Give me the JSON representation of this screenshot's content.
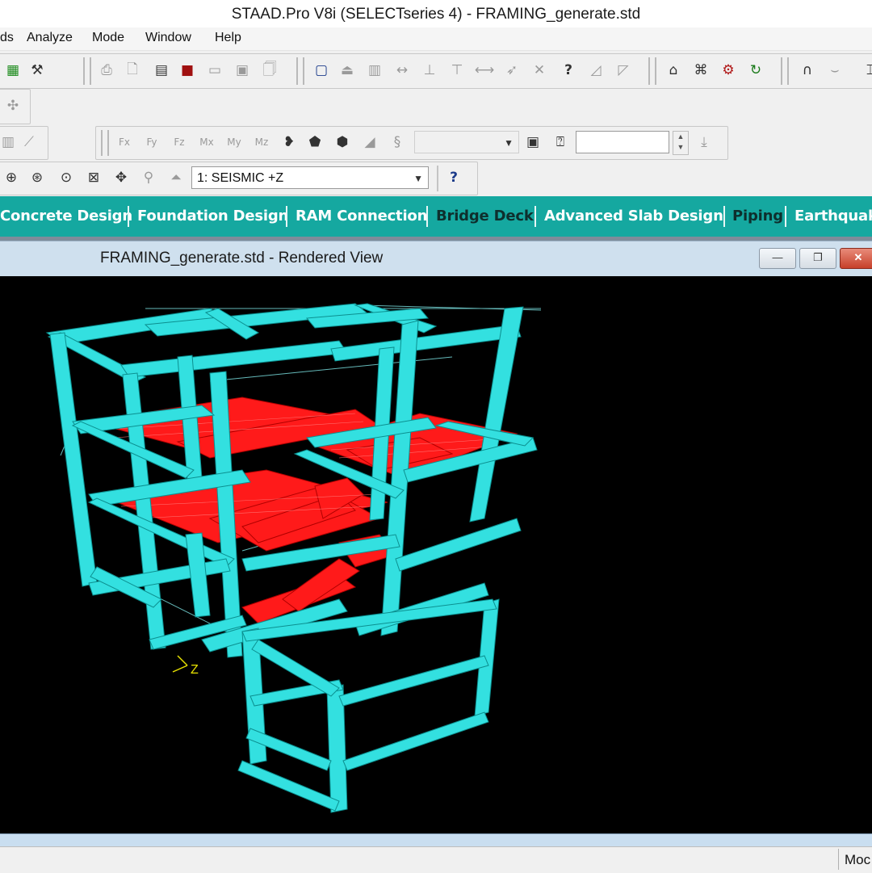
{
  "window": {
    "title": "STAAD.Pro V8i (SELECTseries 4) - FRAMING_generate.std"
  },
  "menu": {
    "items": [
      "ds",
      "Analyze",
      "Mode",
      "Window",
      "Help"
    ]
  },
  "toolbar": {
    "load_case_combo": {
      "value": "1: SEISMIC +Z"
    },
    "help_label": "?",
    "icons": [
      "build-icon",
      "hammer-icon",
      "print-icon",
      "print-preview-icon",
      "calculator-icon",
      "camera-icon",
      "snapshot-icon",
      "report-icon",
      "page-icon",
      "window-icon",
      "support-icon",
      "beam-icon",
      "dimension-icon",
      "node-icon",
      "member-icon",
      "length-icon",
      "cursor-icon",
      "selection-icon",
      "help-icon",
      "plate-icon",
      "solid-icon",
      "structure-wizard-icon",
      "member-query-icon",
      "property-icon",
      "load-icon",
      "section-icon",
      "ground-icon",
      "zoom-in-icon",
      "zoom-out-icon",
      "magnify-icon",
      "zoom-window-icon",
      "pan-icon",
      "search-icon",
      "rotate-icon"
    ]
  },
  "force_toolbar": {
    "labels": [
      "Fx",
      "Fy",
      "Fz",
      "Mx",
      "My",
      "Mz"
    ],
    "combo_value": "",
    "spin_value": ""
  },
  "mode_tabs": [
    {
      "label": "Concrete Design"
    },
    {
      "label": "Foundation Design"
    },
    {
      "label": "RAM Connection"
    },
    {
      "label": "Bridge Deck"
    },
    {
      "label": "Advanced Slab Design"
    },
    {
      "label": "Piping"
    },
    {
      "label": "Earthquak"
    }
  ],
  "child_window": {
    "title": "FRAMING_generate.std - Rendered View",
    "minimize": "—",
    "restore": "❐",
    "close": "✕"
  },
  "viewport": {
    "axis_label": "Z",
    "colors": {
      "background": "#000000",
      "members": "#33e0e0",
      "plates": "#ff1a1a",
      "grid": "#9ff"
    }
  },
  "status": {
    "mode_text": "Moc"
  }
}
